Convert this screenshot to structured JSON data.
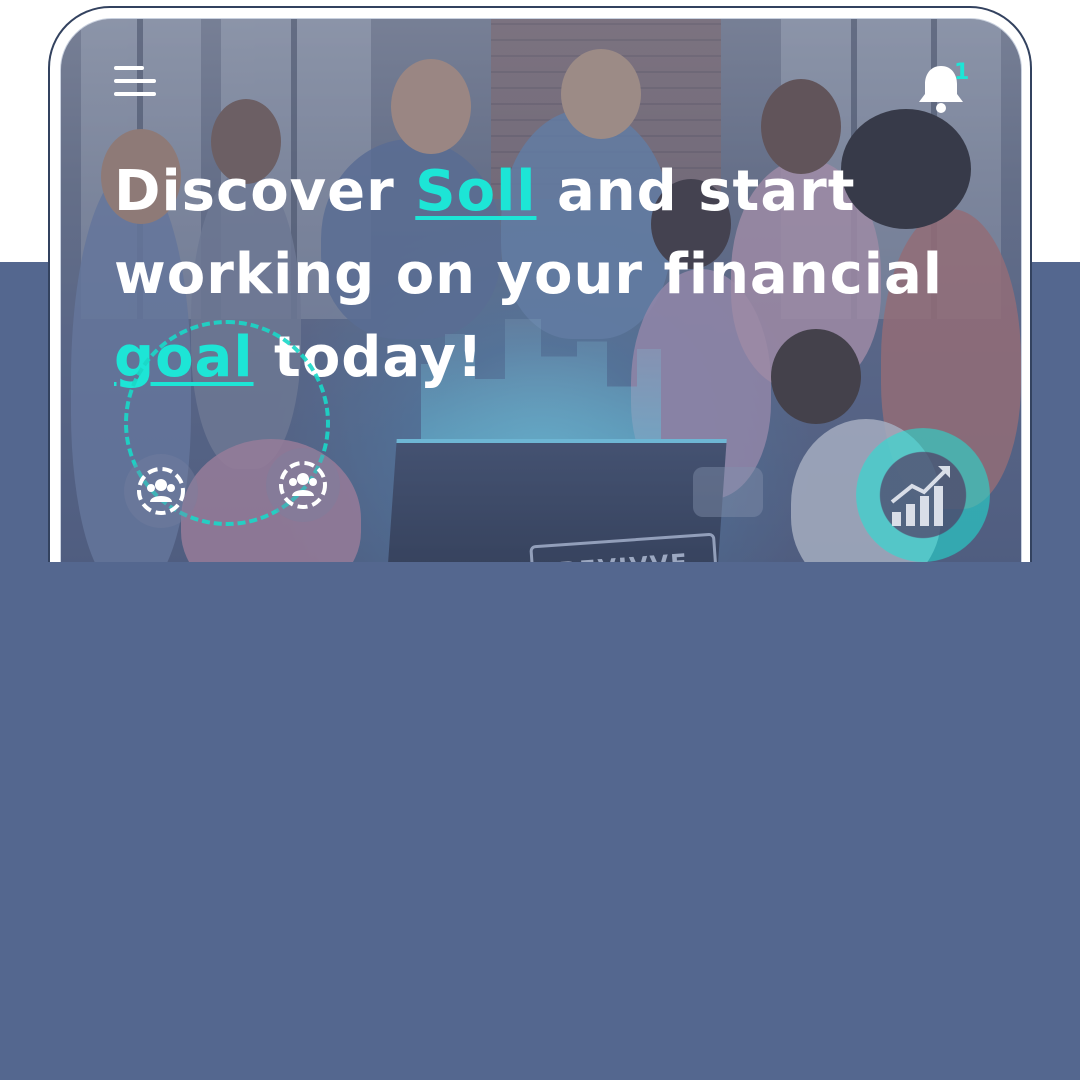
{
  "header": {
    "menu_icon": "hamburger-menu-icon",
    "notification_icon": "bell-icon",
    "notification_count": "1"
  },
  "hero": {
    "headline_pre": "Discover ",
    "headline_accent1": "Soll",
    "headline_mid": " and start working on your financial ",
    "headline_accent2": "goal",
    "headline_post": " today!",
    "pedestal_label": "REVIVVE"
  },
  "feature_icons": [
    "team-gear-icon",
    "team-gear-icon",
    "growth-chart-icon"
  ],
  "colors": {
    "accent": "#1de5d6",
    "background_band": "#54678f",
    "frame": "#33425f",
    "text": "#ffffff"
  }
}
